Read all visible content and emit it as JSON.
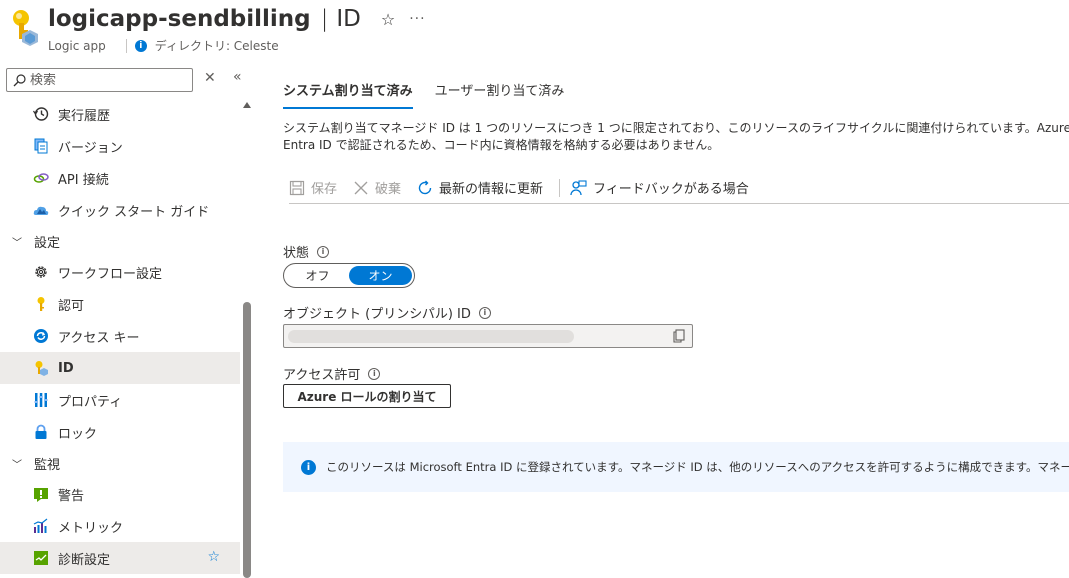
{
  "header": {
    "title": "logicapp-sendbilling",
    "separator": "|",
    "page": "ID",
    "resource_type": "Logic app",
    "directory": "ディレクトリ: Celeste"
  },
  "sidebar": {
    "search_placeholder": "検索",
    "items": [
      {
        "label": "実行履歴",
        "icon": "history-icon"
      },
      {
        "label": "バージョン",
        "icon": "versions-icon"
      },
      {
        "label": "API 接続",
        "icon": "api-connection-icon"
      },
      {
        "label": "クイック スタート ガイド",
        "icon": "quickstart-cloud-icon"
      },
      {
        "group": "設定"
      },
      {
        "label": "ワークフロー設定",
        "icon": "gear-icon"
      },
      {
        "label": "認可",
        "icon": "key-icon"
      },
      {
        "label": "アクセス キー",
        "icon": "access-keys-icon"
      },
      {
        "label": "ID",
        "icon": "identity-icon",
        "selected": true
      },
      {
        "label": "プロパティ",
        "icon": "properties-icon"
      },
      {
        "label": "ロック",
        "icon": "lock-icon"
      },
      {
        "group": "監視"
      },
      {
        "label": "警告",
        "icon": "alert-icon"
      },
      {
        "label": "メトリック",
        "icon": "metrics-icon"
      },
      {
        "label": "診断設定",
        "icon": "diagnostic-settings-icon"
      }
    ]
  },
  "main": {
    "tabs": [
      "システム割り当て済み",
      "ユーザー割り当て済み"
    ],
    "active_tab": 0,
    "description_line1": "システム割り当てマネージド ID は 1 つのリソースにつき 1 つに限定されており、このリソースのライフサイクルに関連付けられています。Azure のロールベースのアクセス",
    "description_line2": "Entra ID で認証されるため、コード内に資格情報を格納する必要はありません。",
    "toolbar": {
      "save": "保存",
      "discard": "破棄",
      "refresh": "最新の情報に更新",
      "feedback": "フィードバックがある場合"
    },
    "status_label": "状態",
    "toggle_off": "オフ",
    "toggle_on": "オン",
    "status_value": "on",
    "object_id_label": "オブジェクト (プリンシパル) ID",
    "permissions_label": "アクセス許可",
    "role_button": "Azure ロールの割り当て",
    "info_text": "このリソースは Microsoft Entra ID に登録されています。マネージド ID は、他のリソースへのアクセスを許可するように構成できます。マネージド ID のアクセス許可",
    "accent_color": "#0078d4"
  }
}
